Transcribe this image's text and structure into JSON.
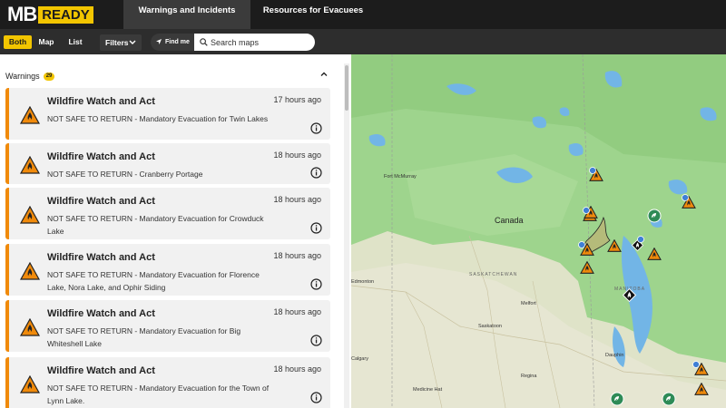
{
  "header": {
    "logo_text": "MB",
    "logo_badge": "READY",
    "tabs": [
      {
        "label": "Warnings and Incidents",
        "active": true
      },
      {
        "label": "Resources for Evacuees",
        "active": false
      }
    ]
  },
  "toolbar": {
    "view_options": [
      "Both",
      "Map",
      "List"
    ],
    "active_view": "Both",
    "filters_label": "Filters",
    "find_me_label": "Find me",
    "search_placeholder": "Search maps",
    "search_value": ""
  },
  "warnings": {
    "title": "Warnings",
    "count": "29",
    "items": [
      {
        "title": "Wildfire Watch and Act",
        "time": "17 hours ago",
        "description": "NOT SAFE TO RETURN - Mandatory Evacuation for Twin Lakes"
      },
      {
        "title": "Wildfire Watch and Act",
        "time": "18 hours ago",
        "description": "NOT SAFE TO RETURN - Cranberry Portage"
      },
      {
        "title": "Wildfire Watch and Act",
        "time": "18 hours ago",
        "description": "NOT SAFE TO RETURN - Mandatory Evacuation for Crowduck Lake"
      },
      {
        "title": "Wildfire Watch and Act",
        "time": "18 hours ago",
        "description": "NOT SAFE TO RETURN - Mandatory Evacuation for Florence Lake, Nora Lake, and Ophir Siding"
      },
      {
        "title": "Wildfire Watch and Act",
        "time": "18 hours ago",
        "description": "NOT SAFE TO RETURN - Mandatory Evacuation for Big Whiteshell Lake"
      },
      {
        "title": "Wildfire Watch and Act",
        "time": "18 hours ago",
        "description": "NOT SAFE TO RETURN - Mandatory Evacuation for the Town of Lynn Lake."
      }
    ]
  },
  "map": {
    "labels": {
      "canada": "Canada",
      "fort_mcmurray": "Fort McMurray",
      "saskatchewan": "SASKATCHEWAN",
      "manitoba": "MANITOBA",
      "edmonton": "Edmonton",
      "melfort": "Melfort",
      "saskatoon": "Saskatoon",
      "calgary": "Calgary",
      "regina": "Regina",
      "medicine_hat": "Medicine Hat",
      "dauphin": "Dauphin"
    },
    "colors": {
      "boreal": "#9ed48d",
      "prairie": "#dfe3c8",
      "water": "#72b5e6",
      "warning_orange": "#f08a0b",
      "resource_green": "#2e8b57"
    }
  }
}
